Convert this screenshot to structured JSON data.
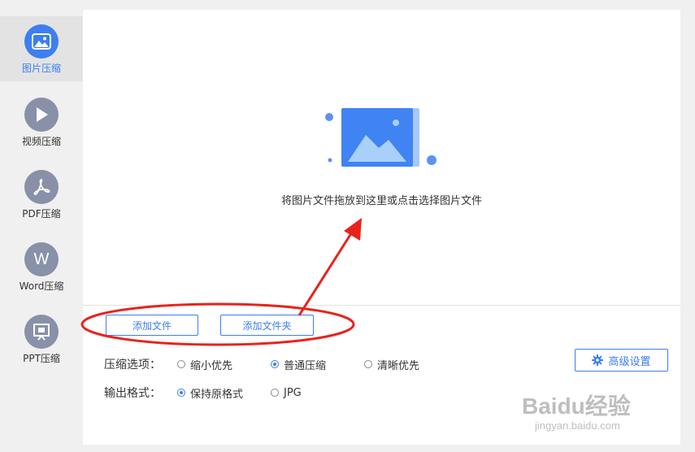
{
  "sidebar": {
    "items": [
      {
        "label": "图片压缩",
        "icon": "image-icon",
        "active": true
      },
      {
        "label": "视频压缩",
        "icon": "play-icon",
        "active": false
      },
      {
        "label": "PDF压缩",
        "icon": "pdf-icon",
        "active": false
      },
      {
        "label": "Word压缩",
        "icon": "word-icon",
        "active": false
      },
      {
        "label": "PPT压缩",
        "icon": "presentation-icon",
        "active": false
      }
    ],
    "word_icon_letter": "W"
  },
  "dropzone": {
    "icon": "image-placeholder-icon",
    "text": "将图片文件拖放到这里或点击选择图片文件"
  },
  "buttons": {
    "add_file": "添加文件",
    "add_folder": "添加文件夹"
  },
  "options": {
    "compression_label": "压缩选项：",
    "compression_choices": [
      {
        "label": "缩小优先",
        "checked": false
      },
      {
        "label": "普通压缩",
        "checked": true
      },
      {
        "label": "清晰优先",
        "checked": false
      }
    ],
    "format_label": "输出格式：",
    "format_choices": [
      {
        "label": "保持原格式",
        "checked": true
      },
      {
        "label": "JPG",
        "checked": false
      }
    ]
  },
  "advanced_settings": {
    "label": "高级设置",
    "icon": "gear-icon"
  },
  "annotation": {
    "color": "#e8231c"
  },
  "watermark": {
    "brand": "Bai",
    "brand_mid": "du",
    "brand_suffix": "经验",
    "url": "jingyan.baidu.com"
  },
  "colors": {
    "accent": "#3d7ef0",
    "sidebar_icon": "#8891a8"
  }
}
